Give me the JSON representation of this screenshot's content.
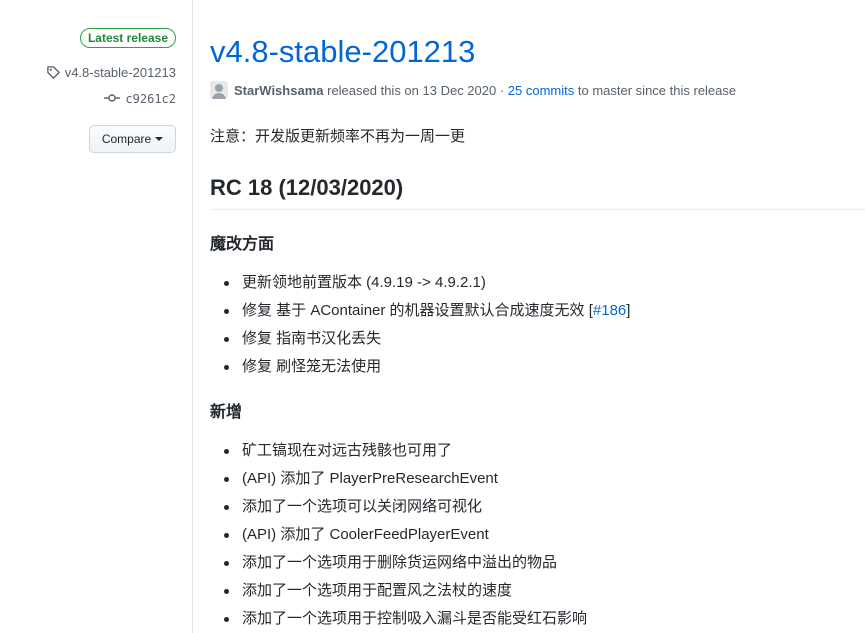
{
  "sidebar": {
    "latest_badge": "Latest release",
    "tag": "v4.8-stable-201213",
    "commit": "c9261c2",
    "compare_label": "Compare"
  },
  "release": {
    "title": "v4.8-stable-201213",
    "author": "StarWishsama",
    "released_text": "released this on 13 Dec 2020 ·",
    "commits_link": "25 commits",
    "commits_suffix": "to master since this release"
  },
  "notice": "注意：开发版更新频率不再为一周一更",
  "section": {
    "heading": "RC 18 (12/03/2020)",
    "groups": [
      {
        "title": "魔改方面",
        "items": [
          "更新领地前置版本 (4.9.19 -> 4.9.2.1)",
          "修复 基于 AContainer 的机器设置默认合成速度无效 [",
          "修复 指南书汉化丢失",
          "修复 刷怪笼无法使用"
        ],
        "issue_link": "#186",
        "issue_suffix": "]"
      },
      {
        "title": "新增",
        "items": [
          "矿工镐现在对远古残骸也可用了",
          "(API) 添加了 PlayerPreResearchEvent",
          "添加了一个选项可以关闭网络可视化",
          "(API) 添加了 CoolerFeedPlayerEvent",
          "添加了一个选项用于删除货运网络中溢出的物品",
          "添加了一个选项用于配置风之法杖的速度",
          "添加了一个选项用于控制吸入漏斗是否能受红石影响"
        ]
      }
    ]
  },
  "colors": {
    "link": "#0366d6",
    "badge_green": "#28a745",
    "text": "#24292e",
    "muted": "#586069"
  }
}
